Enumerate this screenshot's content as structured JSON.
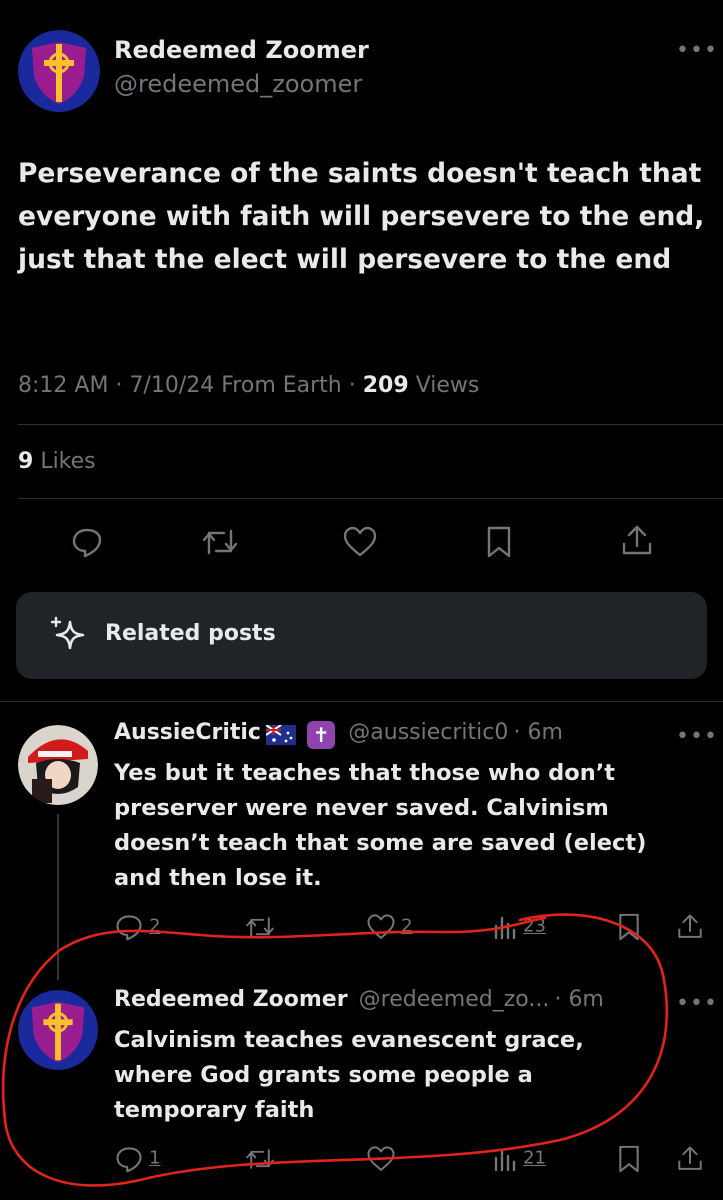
{
  "main_tweet": {
    "author_name": "Redeemed Zoomer",
    "author_handle": "@redeemed_zoomer",
    "more_icon": "ellipsis-icon",
    "text": "Perseverance of the saints doesn't teach that everyone with faith will persevere to the end, just that the elect will persevere to the end",
    "time": "8:12 AM",
    "date": "7/10/24",
    "source": "From Earth",
    "views_count": "209",
    "views_label": "Views",
    "likes_count": "9",
    "likes_label": "Likes",
    "actions": [
      "reply-icon",
      "retweet-icon",
      "like-icon",
      "bookmark-icon",
      "share-icon"
    ]
  },
  "related_posts": {
    "label": "Related posts",
    "icon": "sparkle-icon"
  },
  "replies": [
    {
      "author_name": "AussieCritic",
      "badges": [
        "australia-flag-icon",
        "latin-cross-icon"
      ],
      "cross_glyph": "✝",
      "author_handle": "@aussiecritic0",
      "time": "6m",
      "text": "Yes but it teaches that those who don’t preserver were never saved. Calvinism doesn’t teach that some are saved (elect) and then lose it.",
      "reply_count": "2",
      "retweet_count": "",
      "like_count": "2",
      "views_count": "23"
    },
    {
      "author_name": "Redeemed Zoomer",
      "author_handle": "@redeemed_zo...",
      "time": "6m",
      "text": "Calvinism teaches evanescent grace, where God grants some people a temporary faith",
      "reply_count": "1",
      "retweet_count": "",
      "like_count": "",
      "views_count": "21"
    }
  ],
  "colors": {
    "background": "#000000",
    "text": "#e7e9ea",
    "secondary": "#71767b",
    "card": "#202327",
    "annotation_red": "#e0241b"
  }
}
